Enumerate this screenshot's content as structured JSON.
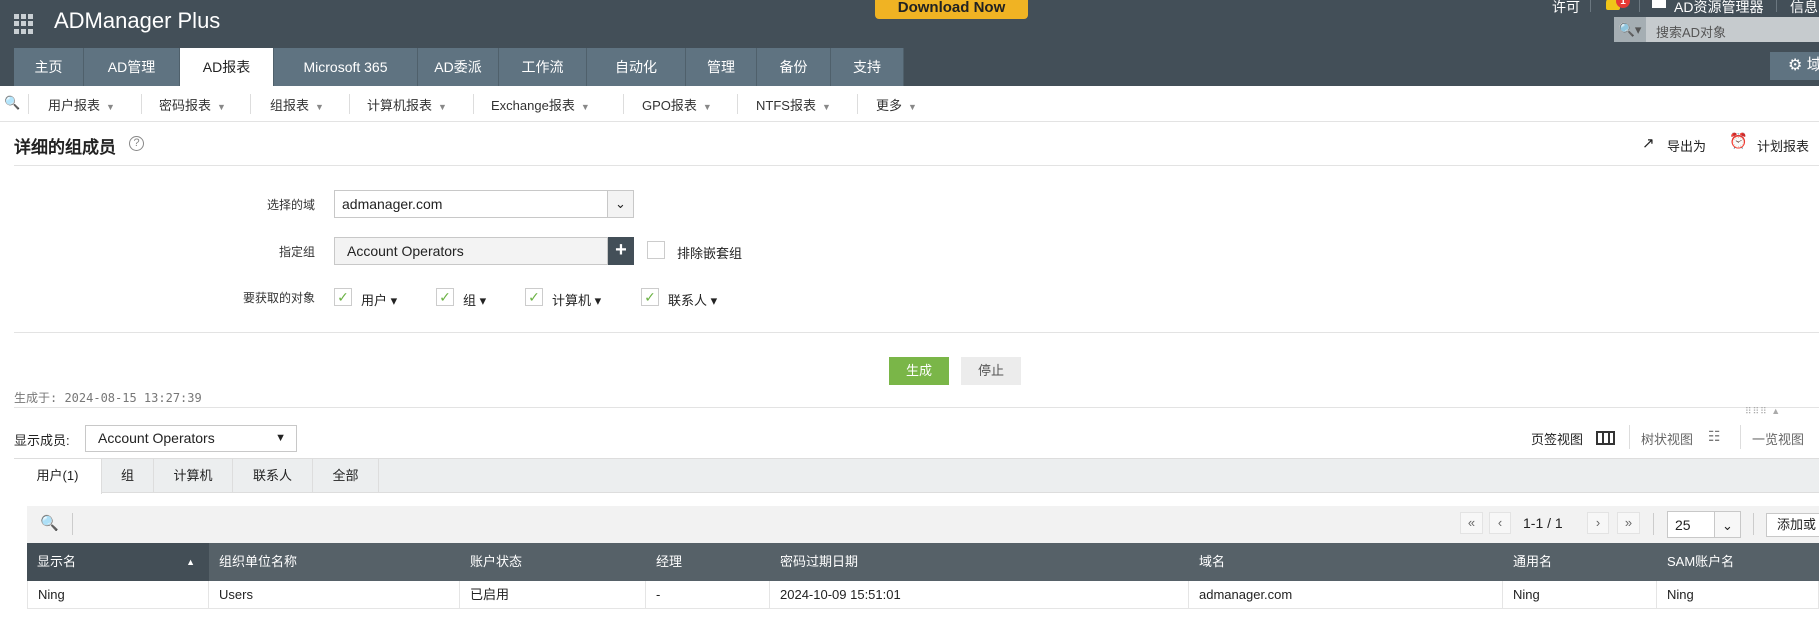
{
  "header": {
    "app_name": "ADManager Plus",
    "download_label": "Download Now",
    "license": "许可",
    "notification_count": "1",
    "ad_explorer": "AD资源管理器",
    "info": "信息",
    "search_placeholder": "搜索AD对象",
    "domain_settings": "域"
  },
  "main_tabs": [
    "主页",
    "AD管理",
    "AD报表",
    "Microsoft 365",
    "AD委派",
    "工作流",
    "自动化",
    "管理",
    "备份",
    "支持"
  ],
  "sub_nav": [
    "用户报表",
    "密码报表",
    "组报表",
    "计算机报表",
    "Exchange报表",
    "GPO报表",
    "NTFS报表",
    "更多"
  ],
  "page": {
    "title": "详细的组成员",
    "export": "导出为",
    "schedule": "计划报表"
  },
  "form": {
    "domain_label": "选择的域",
    "domain_value": "admanager.com",
    "group_label": "指定组",
    "group_value": "Account Operators",
    "exclude_nested": "排除嵌套组",
    "objects_label": "要获取的对象",
    "objects": [
      "用户",
      "组",
      "计算机",
      "联系人"
    ]
  },
  "actions": {
    "generate": "生成",
    "stop": "停止"
  },
  "generated_at": "生成于: 2024-08-15 13:27:39",
  "show_members": {
    "label": "显示成员:",
    "value": "Account Operators"
  },
  "views": {
    "tab_view": "页签视图",
    "tree_view": "树状视图",
    "list_view": "一览视图"
  },
  "result_tabs": [
    "用户(1)",
    "组",
    "计算机",
    "联系人",
    "全部"
  ],
  "pager": {
    "range": "1-1 / 1",
    "page_size": "25",
    "add_remove": "添加或"
  },
  "table": {
    "columns": [
      "显示名",
      "组织单位名称",
      "账户状态",
      "经理",
      "密码过期日期",
      "域名",
      "通用名",
      "SAM账户名"
    ],
    "rows": [
      [
        "Ning",
        "Users",
        "已启用",
        "-",
        "2024-10-09 15:51:01",
        "admanager.com",
        "Ning",
        "Ning"
      ]
    ]
  },
  "colors": {
    "header": "#434f58",
    "tab": "#5f7381",
    "accent_green": "#7ab648",
    "table_header": "#566168"
  }
}
